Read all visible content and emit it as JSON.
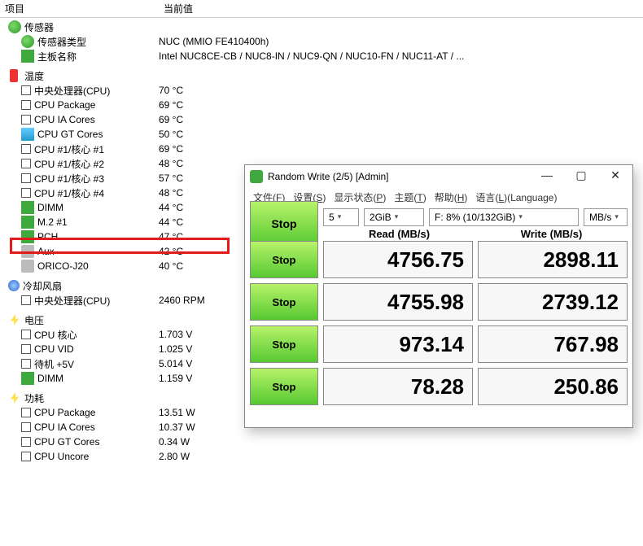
{
  "columns": {
    "item": "项目",
    "value": "当前值"
  },
  "sensor": {
    "header": "传感器",
    "type_label": "传感器类型",
    "type_value": "NUC  (MMIO FE410400h)",
    "board_label": "主板名称",
    "board_value": "Intel NUC8CE-CB / NUC8-IN / NUC9-QN / NUC10-FN / NUC11-AT / ..."
  },
  "temperature": {
    "header": "温度",
    "rows": [
      {
        "label": "中央处理器(CPU)",
        "value": "70 °C",
        "icon": "check"
      },
      {
        "label": "CPU Package",
        "value": "69 °C",
        "icon": "check"
      },
      {
        "label": "CPU IA Cores",
        "value": "69 °C",
        "icon": "check"
      },
      {
        "label": "CPU GT Cores",
        "value": "50 °C",
        "icon": "gpu"
      },
      {
        "label": "CPU #1/核心 #1",
        "value": "69 °C",
        "icon": "check"
      },
      {
        "label": "CPU #1/核心 #2",
        "value": "48 °C",
        "icon": "check"
      },
      {
        "label": "CPU #1/核心 #3",
        "value": "57 °C",
        "icon": "check"
      },
      {
        "label": "CPU #1/核心 #4",
        "value": "48 °C",
        "icon": "check"
      },
      {
        "label": "DIMM",
        "value": "44 °C",
        "icon": "green"
      },
      {
        "label": "M.2 #1",
        "value": "44 °C",
        "icon": "green"
      },
      {
        "label": "PCH",
        "value": "47 °C",
        "icon": "green"
      },
      {
        "label": "Aux",
        "value": "42 °C",
        "icon": "disk"
      },
      {
        "label": "ORICO-J20",
        "value": "40 °C",
        "icon": "disk"
      }
    ]
  },
  "fan": {
    "header": "冷却风扇",
    "rows": [
      {
        "label": "中央处理器(CPU)",
        "value": "2460 RPM",
        "icon": "check"
      }
    ]
  },
  "voltage": {
    "header": "电压",
    "rows": [
      {
        "label": "CPU 核心",
        "value": "1.703 V",
        "icon": "check"
      },
      {
        "label": "CPU VID",
        "value": "1.025 V",
        "icon": "check"
      },
      {
        "label": "待机 +5V",
        "value": "5.014 V",
        "icon": "check"
      },
      {
        "label": "DIMM",
        "value": "1.159 V",
        "icon": "green"
      }
    ]
  },
  "power": {
    "header": "功耗",
    "rows": [
      {
        "label": "CPU Package",
        "value": "13.51 W",
        "icon": "check"
      },
      {
        "label": "CPU IA Cores",
        "value": "10.37 W",
        "icon": "check"
      },
      {
        "label": "CPU GT Cores",
        "value": "0.34 W",
        "icon": "check"
      },
      {
        "label": "CPU Uncore",
        "value": "2.80 W",
        "icon": "check"
      }
    ]
  },
  "cdm": {
    "title": "Random Write (2/5) [Admin]",
    "menu": {
      "file": "文件(F)",
      "settings": "设置(S)",
      "profile": "显示状态(P)",
      "theme": "主题(T)",
      "help": "帮助(H)",
      "language": "语言(L)(Language)"
    },
    "stop": "Stop",
    "loops": "5",
    "size": "2GiB",
    "drive": "F: 8% (10/132GiB)",
    "unit": "MB/s",
    "read_hdr": "Read (MB/s)",
    "write_hdr": "Write (MB/s)",
    "rows": [
      {
        "read": "4756.75",
        "write": "2898.11"
      },
      {
        "read": "4755.98",
        "write": "2739.12"
      },
      {
        "read": "973.14",
        "write": "767.98"
      },
      {
        "read": "78.28",
        "write": "250.86"
      }
    ]
  }
}
